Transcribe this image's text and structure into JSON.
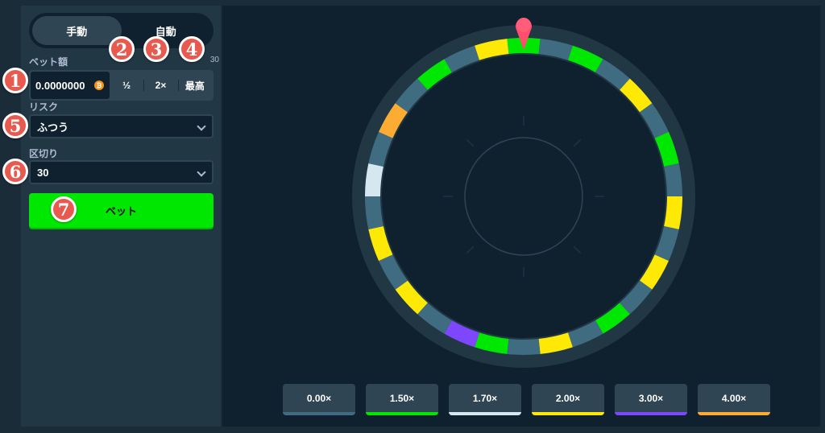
{
  "sidebar": {
    "tabs": {
      "manual": "手動",
      "auto": "自動"
    },
    "bet_amount": {
      "label": "ベット額",
      "balance_hint": "30",
      "value": "0.0000000",
      "currency_icon": "bitcoin-icon",
      "half_label": "½",
      "double_label": "2×",
      "max_label": "最高"
    },
    "risk": {
      "label": "リスク",
      "value": "ふつう"
    },
    "segments": {
      "label": "区切り",
      "value": "30"
    },
    "bet_button_label": "ベット"
  },
  "badges": [
    "1",
    "2",
    "3",
    "4",
    "5",
    "6",
    "7"
  ],
  "wheel": {
    "segment_count": 30,
    "segments": [
      "green",
      "gray",
      "green",
      "gray",
      "yellow",
      "gray",
      "green",
      "gray",
      "yellow",
      "gray",
      "yellow",
      "gray",
      "green",
      "gray",
      "yellow",
      "gray",
      "green",
      "purple",
      "gray",
      "yellow",
      "gray",
      "yellow",
      "gray",
      "white",
      "gray",
      "orange",
      "gray",
      "green",
      "gray",
      "yellow"
    ],
    "pointer_color": "#ff4d6d"
  },
  "multipliers": [
    {
      "label": "0.00×",
      "color": "#406c82"
    },
    {
      "label": "1.50×",
      "color": "#00e701"
    },
    {
      "label": "1.70×",
      "color": "#d5e8f2"
    },
    {
      "label": "2.00×",
      "color": "#fde905"
    },
    {
      "label": "3.00×",
      "color": "#7f47fd"
    },
    {
      "label": "4.00×",
      "color": "#fcac33"
    }
  ],
  "colors": {
    "green": "#00e701",
    "yellow": "#fde905",
    "purple": "#7f47fd",
    "orange": "#fcac33",
    "white": "#d5e8f2",
    "gray": "#406c82",
    "ring_outer": "#213743",
    "accent_badge": "#e85a4f"
  }
}
